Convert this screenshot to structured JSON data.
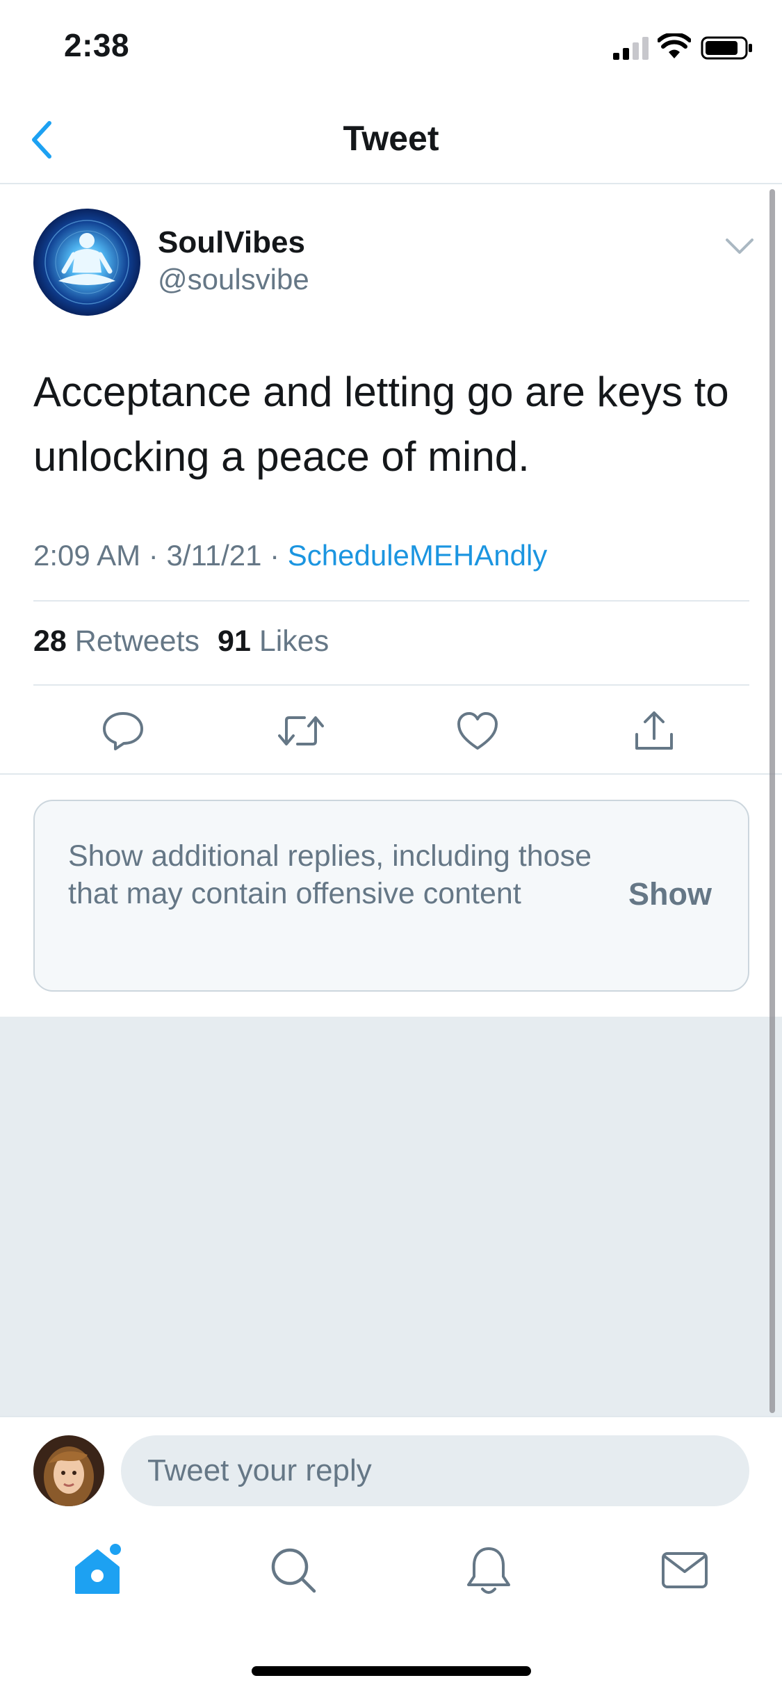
{
  "status_bar": {
    "time": "2:38"
  },
  "nav": {
    "title": "Tweet"
  },
  "tweet": {
    "author_name": "SoulVibes",
    "author_handle": "@soulsvibe",
    "text": "Acceptance and letting go are keys to unlocking a peace of mind.",
    "time": "2:09 AM",
    "date": "3/11/21",
    "source": "ScheduleMEHAndly",
    "retweet_count": "28",
    "retweet_label": "Retweets",
    "like_count": "91",
    "like_label": "Likes"
  },
  "more_replies": {
    "text": "Show additional replies, including those that may contain offensive content",
    "button_label": "Show"
  },
  "reply_box": {
    "placeholder": "Tweet your reply"
  },
  "colors": {
    "accent": "#1da1f2",
    "link": "#1b95e0",
    "secondary_text": "#657786",
    "divider": "#e1e8ed",
    "background_gray": "#e6ecf0"
  },
  "icons": {
    "back": "chevron-left-icon",
    "tweet_menu": "chevron-down-icon",
    "reply": "reply-icon",
    "retweet": "retweet-icon",
    "like": "heart-icon",
    "share": "share-icon",
    "home": "home-icon",
    "search": "search-icon",
    "notifications": "bell-icon",
    "messages": "mail-icon"
  }
}
